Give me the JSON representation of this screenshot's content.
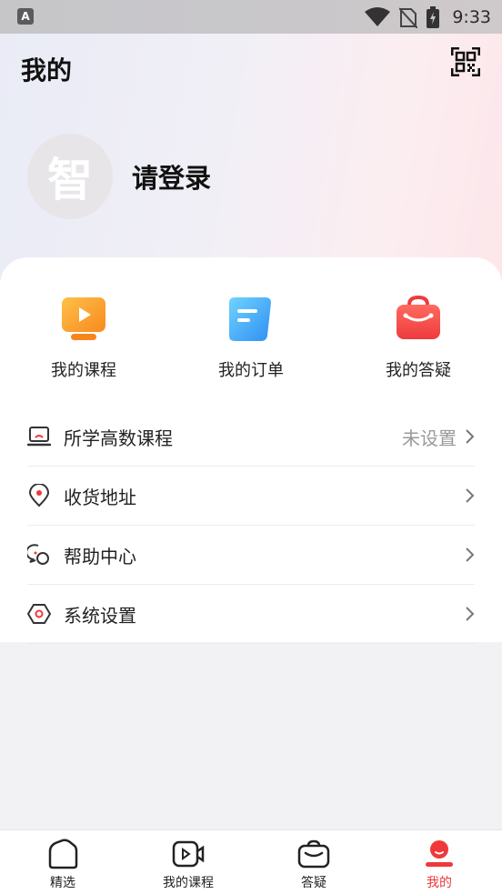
{
  "status_bar": {
    "time": "9:33",
    "app_icon_letter": "A"
  },
  "header": {
    "title": "我的"
  },
  "profile": {
    "avatar_text": "智",
    "login_prompt": "请登录"
  },
  "quick_actions": [
    {
      "label": "我的课程",
      "icon": "video-course-icon",
      "color": "#f9a033"
    },
    {
      "label": "我的订单",
      "icon": "order-document-icon",
      "color": "#3da8f5"
    },
    {
      "label": "我的答疑",
      "icon": "qa-briefcase-icon",
      "color": "#f2484a"
    }
  ],
  "menu": [
    {
      "label": "所学高数课程",
      "value": "未设置",
      "icon": "laptop-icon"
    },
    {
      "label": "收货地址",
      "value": "",
      "icon": "location-pin-icon"
    },
    {
      "label": "帮助中心",
      "value": "",
      "icon": "chat-bubbles-icon"
    },
    {
      "label": "系统设置",
      "value": "",
      "icon": "hexagon-settings-icon"
    }
  ],
  "tabbar": [
    {
      "label": "精选",
      "icon": "home-icon",
      "active": false
    },
    {
      "label": "我的课程",
      "icon": "video-camera-icon",
      "active": false
    },
    {
      "label": "答疑",
      "icon": "qa-bag-icon",
      "active": false
    },
    {
      "label": "我的",
      "icon": "user-profile-icon",
      "active": true
    }
  ],
  "colors": {
    "accent": "#f0383a",
    "text": "#222222",
    "muted": "#999999"
  }
}
